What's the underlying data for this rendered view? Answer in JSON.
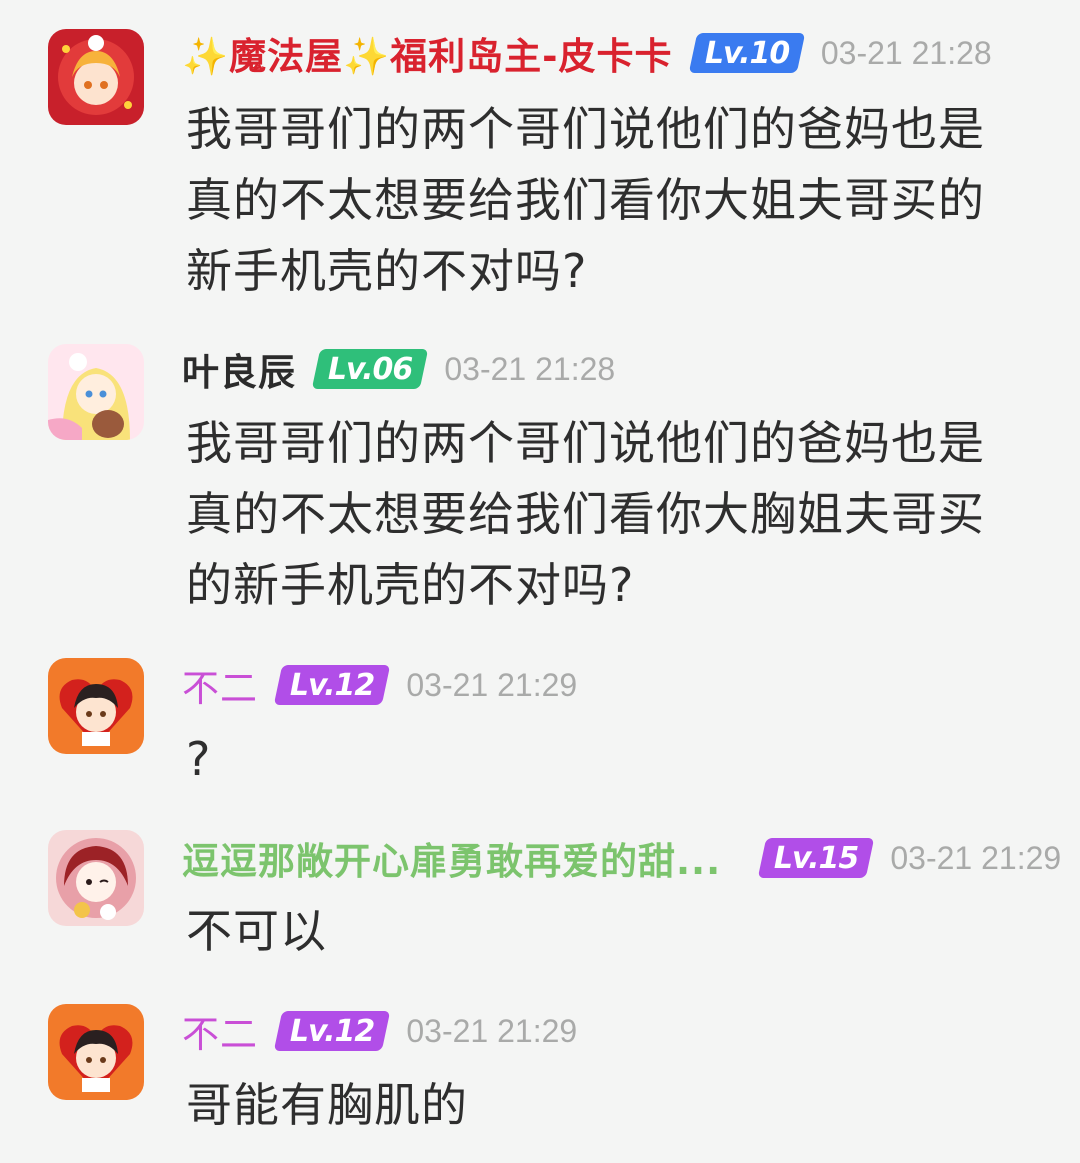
{
  "comments": [
    {
      "name": "✨魔法屋✨福利岛主-皮卡卡",
      "level": "Lv.10",
      "time": "03-21 21:28",
      "text": "我哥哥们的两个哥们说他们的爸妈也是真的不太想要给我们看你大姐夫哥买的新手机壳的不对吗?"
    },
    {
      "name": "叶良辰",
      "level": "Lv.06",
      "time": "03-21 21:28",
      "text": "我哥哥们的两个哥们说他们的爸妈也是真的不太想要给我们看你大胸姐夫哥买的新手机壳的不对吗?"
    },
    {
      "name": "不二",
      "level": "Lv.12",
      "time": "03-21 21:29",
      "text": "?"
    },
    {
      "name": "逗逗那敞开心扉勇敢再爱的甜...",
      "level": "Lv.15",
      "time": "03-21 21:29",
      "text": "不可以"
    },
    {
      "name": "不二",
      "level": "Lv.12",
      "time": "03-21 21:29",
      "text": "哥能有胸肌的"
    }
  ],
  "colors": {
    "name_red": "#d9222e",
    "name_dark": "#2b2b2b",
    "name_pink": "#c94fd6",
    "name_green": "#7cc46d",
    "badge_blue": "#3a7bf0",
    "badge_green": "#2fbf7a",
    "badge_purple": "#b14ee8",
    "time_gray": "#a9aaa9"
  }
}
